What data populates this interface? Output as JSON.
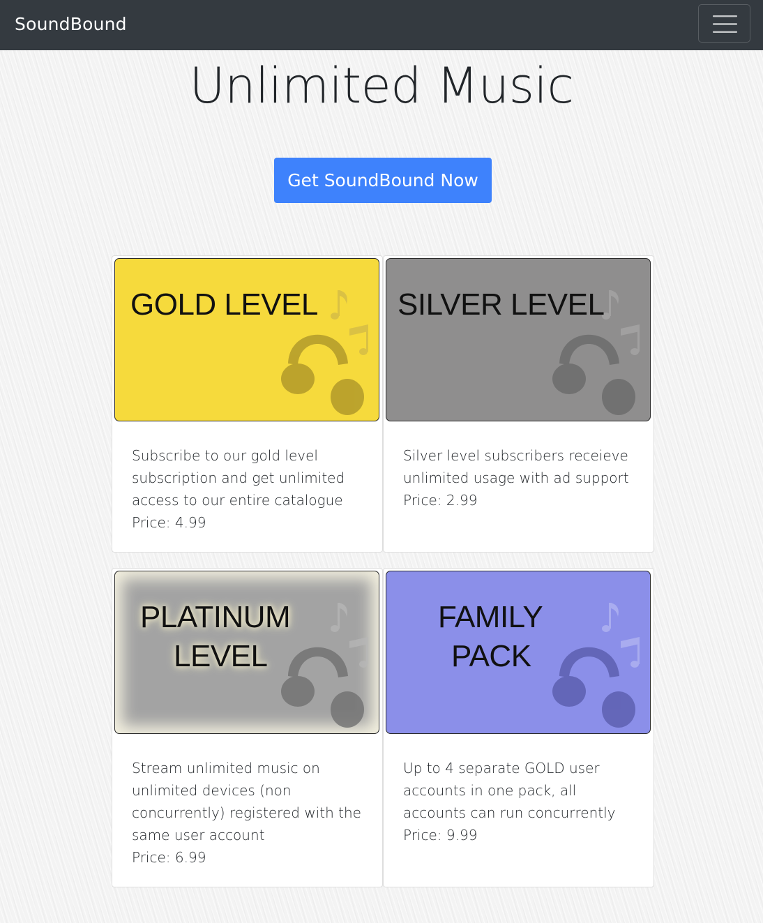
{
  "navbar": {
    "brand": "SoundBound",
    "menu_icon": "hamburger-menu-icon"
  },
  "hero": {
    "title": "Unlimited Music",
    "cta_label": "Get SoundBound Now",
    "cta_color": "#3e82fc"
  },
  "plans": [
    {
      "image_text": [
        "GOLD LEVEL"
      ],
      "image_color": "#f6da3c",
      "description": "Subscribe to our gold level subscription and get unlimited access to our entire catalogue",
      "price": "Price: 4.99"
    },
    {
      "image_text": [
        "SILVER LEVEL"
      ],
      "image_color": "#8f8e8e",
      "description": "Silver level subscribers receieve unlimited usage with ad support",
      "price": "Price: 2.99"
    },
    {
      "image_text": [
        "PLATINUM",
        "LEVEL"
      ],
      "image_color": "#a3a3a3",
      "description": "Stream unlimited music on unlimited devices (non concurrently) registered with the same user account",
      "price": "Price: 6.99"
    },
    {
      "image_text": [
        "FAMILY",
        "PACK"
      ],
      "image_color": "#8b8fe9",
      "description": "Up to 4 separate GOLD user accounts in one pack, all accounts can run concurrently",
      "price": "Price: 9.99"
    }
  ]
}
